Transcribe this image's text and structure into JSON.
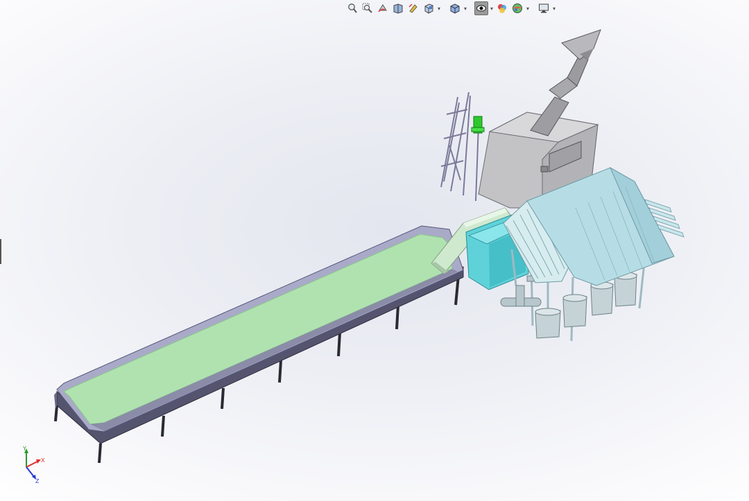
{
  "heads_up_toolbar": {
    "items": [
      {
        "id": "zoom-to-fit",
        "icon": "zoom-to-fit-icon"
      },
      {
        "id": "zoom-to-area",
        "icon": "zoom-to-area-icon"
      },
      {
        "id": "previous-view",
        "icon": "previous-view-icon"
      },
      {
        "id": "section-view",
        "icon": "section-view-icon"
      },
      {
        "id": "dynamic-annotation",
        "icon": "dynamic-annotation-icon"
      },
      {
        "id": "view-orientation",
        "icon": "view-orientation-icon",
        "has_dropdown": true
      },
      {
        "id": "display-style",
        "icon": "display-style-icon",
        "has_dropdown": true
      },
      {
        "id": "hide-show-items",
        "icon": "hide-show-items-icon",
        "has_dropdown": true,
        "active": true
      },
      {
        "id": "edit-appearance",
        "icon": "edit-appearance-icon"
      },
      {
        "id": "apply-scene",
        "icon": "apply-scene-icon",
        "has_dropdown": true
      },
      {
        "id": "view-settings",
        "icon": "view-settings-icon",
        "has_dropdown": true
      }
    ]
  },
  "triad": {
    "x_label": "X",
    "y_label": "Y",
    "z_label": "Z",
    "x_color": "#e0302a",
    "y_color": "#2a9a2a",
    "z_color": "#2a3ad0"
  },
  "colors": {
    "tank_liquid": "#b0e2b0",
    "tank_wall": "#5b5a78",
    "tank_rim": "#a7a8c8",
    "hopper_body": "#c9c9cc",
    "cyan_tank": "#66d6dc",
    "roof_panels": "#b8dfe8",
    "green_motor": "#2ec82e"
  }
}
